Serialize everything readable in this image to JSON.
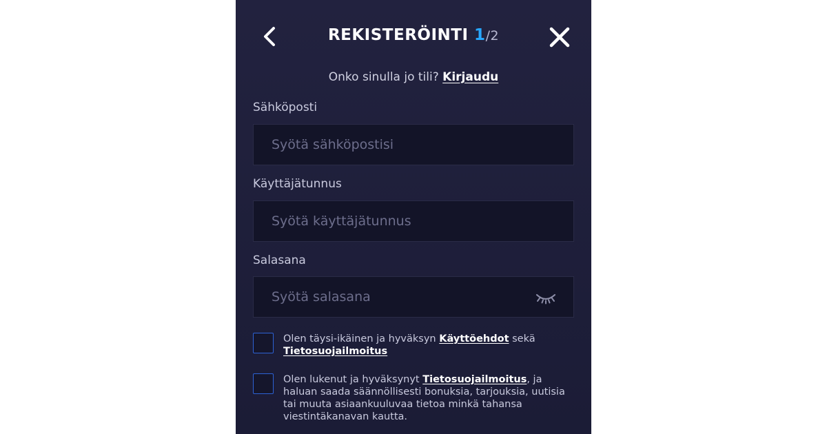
{
  "header": {
    "title": "REKISTERÖINTI",
    "step": "1",
    "total": "/2",
    "back_icon": "chevron-left-icon",
    "close_icon": "close-icon"
  },
  "login_prompt": {
    "text": "Onko sinulla jo tili?",
    "link": "Kirjaudu"
  },
  "form": {
    "email": {
      "label": "Sähköposti",
      "placeholder": "Syötä sähköpostisi",
      "value": ""
    },
    "username": {
      "label": "Käyttäjätunnus",
      "placeholder": "Syötä käyttäjätunnus",
      "value": ""
    },
    "password": {
      "label": "Salasana",
      "placeholder": "Syötä salasana",
      "value": "",
      "toggle_icon": "eye-closed-icon"
    }
  },
  "consents": {
    "terms": {
      "checked": false,
      "text_before": "Olen täysi-ikäinen ja hyväksyn ",
      "link1": "Käyttöehdot",
      "text_middle": " sekä ",
      "link2": "Tietosuojailmoitus"
    },
    "marketing": {
      "checked": false,
      "text_before": "Olen lukenut ja hyväksynyt ",
      "link": "Tietosuojailmoitus",
      "text_after": ", ja haluan saada säännöllisesti bonuksia, tarjouksia, uutisia tai muuta asiaankuuluvaa tietoa minkä tahansa viestintäkanavan kautta."
    }
  },
  "colors": {
    "panel_background": "#1f2039",
    "input_background": "#131428",
    "accent_blue": "#27a7ff",
    "checkbox_border": "#2d62d6",
    "text_primary": "#ffffff",
    "text_secondary": "#c9cade"
  }
}
